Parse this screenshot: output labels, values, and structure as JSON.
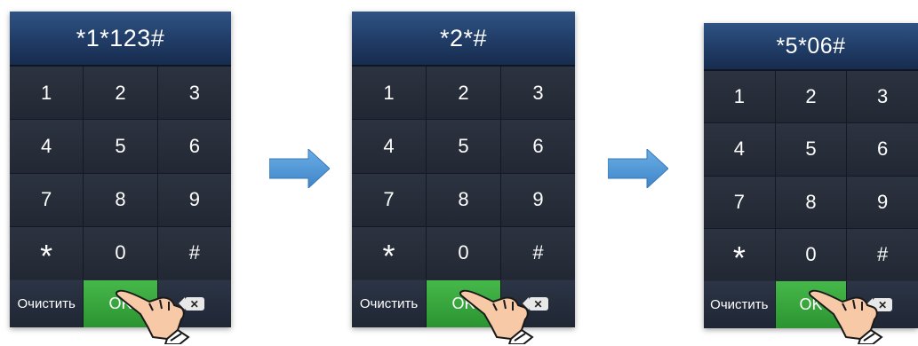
{
  "screens": [
    {
      "display": "*1*123#",
      "keys": [
        "1",
        "2",
        "3",
        "4",
        "5",
        "6",
        "7",
        "8",
        "9",
        "*",
        "0",
        "#"
      ],
      "clear_label": "Очистить",
      "ok_label": "OK",
      "backspace_icon": "backspace-icon"
    },
    {
      "display": "*2*#",
      "keys": [
        "1",
        "2",
        "3",
        "4",
        "5",
        "6",
        "7",
        "8",
        "9",
        "*",
        "0",
        "#"
      ],
      "clear_label": "Очистить",
      "ok_label": "OK",
      "backspace_icon": "backspace-icon"
    },
    {
      "display": "*5*06#",
      "keys": [
        "1",
        "2",
        "3",
        "4",
        "5",
        "6",
        "7",
        "8",
        "9",
        "*",
        "0",
        "#"
      ],
      "clear_label": "Очистить",
      "ok_label": "OK",
      "backspace_icon": "backspace-icon"
    }
  ],
  "colors": {
    "display": "#203c66",
    "keypad": "#262c38",
    "ok": "#3aa640",
    "arrow": "#4a90d2"
  }
}
